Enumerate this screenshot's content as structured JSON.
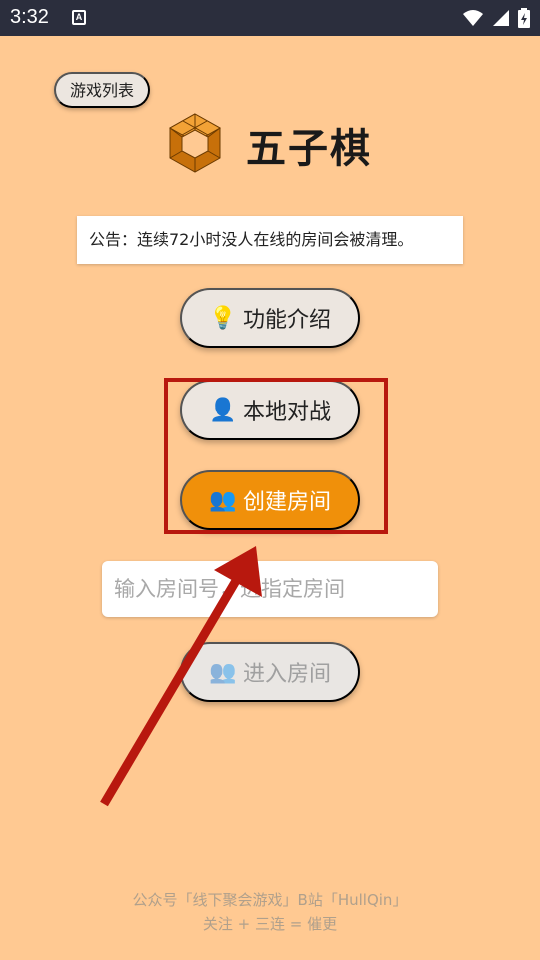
{
  "status_bar": {
    "time": "3:32",
    "app_icon_letter": "A"
  },
  "header": {
    "list_button_label": "游戏列表",
    "title": "五子棋"
  },
  "notice": {
    "text": "公告：连续72小时没人在线的房间会被清理。"
  },
  "buttons": {
    "intro_label": "功能介绍",
    "local_battle_label": "本地对战",
    "create_room_label": "创建房间",
    "enter_room_label": "进入房间"
  },
  "room_input": {
    "placeholder": "输入房间号，进指定房间",
    "value": ""
  },
  "footer": {
    "line1": "公众号「线下聚会游戏」B站「HullQin」",
    "line2": "关注 + 三连 = 催更"
  },
  "colors": {
    "background": "#FFC992",
    "primary": "#F0900A",
    "annotation": "#B8180E"
  },
  "icons": {
    "intro": "lightbulb-icon",
    "local_battle": "person-icon",
    "create_room": "people-icon",
    "enter_room": "people-icon"
  }
}
